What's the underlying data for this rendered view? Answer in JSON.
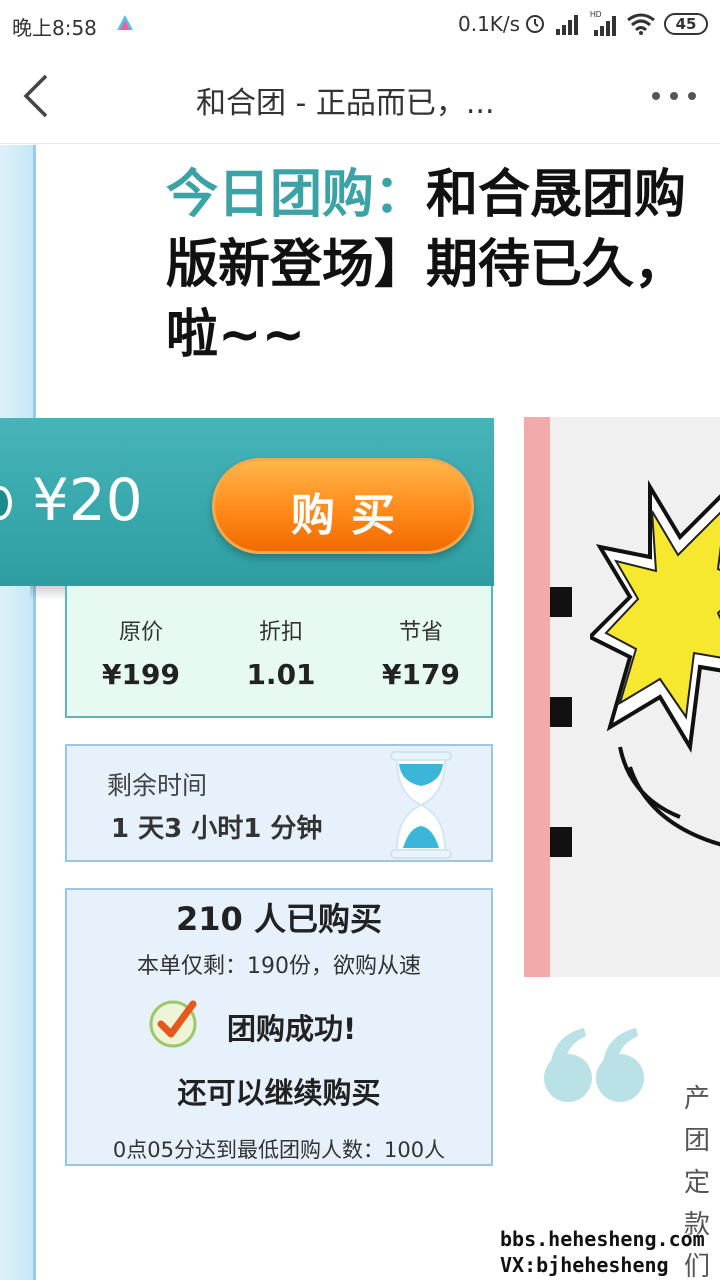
{
  "status_bar": {
    "time": "晚上8:58",
    "network_speed": "0.1K/s",
    "battery": "45",
    "icons": [
      "app-notification-icon",
      "alarm-icon",
      "signal-icon",
      "hd-signal-icon",
      "wifi-icon",
      "battery-icon"
    ]
  },
  "nav": {
    "title": "和合团 - 正品而已，...",
    "icons": [
      "back-chevron-icon",
      "more-dots-icon"
    ]
  },
  "headline": {
    "label": "今日团购：",
    "line1_text": "和合晟团购",
    "line2": "版新登场】期待已久，",
    "line3": "啦~~"
  },
  "deal": {
    "price": "¥20",
    "buy_label": "购买",
    "stats": [
      {
        "label": "原价",
        "value": "¥199"
      },
      {
        "label": "折扣",
        "value": "1.01"
      },
      {
        "label": "节省",
        "value": "¥179"
      }
    ],
    "time_label": "剩余时间",
    "time_value": "1  天3  小时1  分钟",
    "bought": "210 人已购买",
    "remaining": "本单仅剩：190份，欲购从速",
    "success": "团购成功!",
    "continue": "还可以继续购买",
    "min_info": "0点05分达到最低团购人数：100人"
  },
  "side_text": [
    "产",
    "团",
    "定",
    "款",
    "们"
  ],
  "watermark": {
    "line1": "bbs.hehesheng.com",
    "line2": "VX:bjhehesheng"
  },
  "colors": {
    "teal": "#3ba3a6",
    "orange": "#ff8a1a",
    "mint": "#e6faf2",
    "light_blue": "#e6f1fb"
  }
}
